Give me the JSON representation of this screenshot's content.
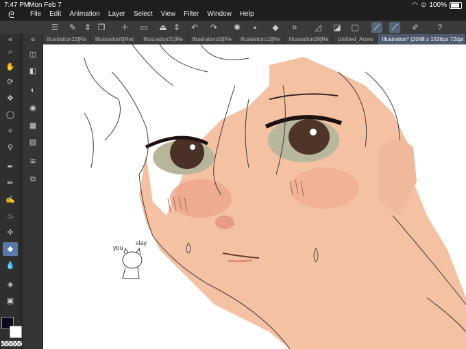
{
  "status": {
    "time": "7:47 PM",
    "date": "Mon Feb 7",
    "battery": "100%"
  },
  "menu": [
    "File",
    "Edit",
    "Animation",
    "Layer",
    "Select",
    "View",
    "Filter",
    "Window",
    "Help"
  ],
  "tabs": [
    {
      "label": "Illustration22[Re",
      "active": false
    },
    {
      "label": "Illustration5[Rec",
      "active": false
    },
    {
      "label": "Illustration31[Re",
      "active": false
    },
    {
      "label": "Illustration33[Re",
      "active": false
    },
    {
      "label": "Illustration12[Re",
      "active": false
    },
    {
      "label": "Illustration29[Re",
      "active": false
    },
    {
      "label": "Untitled_Artwo",
      "active": false
    },
    {
      "label": "Illustration* (2048 x 1536px 72dpi 231.0%)",
      "active": true
    }
  ],
  "canvas_text": {
    "note1": "you",
    "note2": "slay"
  },
  "colors": {
    "foreground": "#0a0a1a",
    "background": "#ffffff",
    "skin": "#f4c1a3",
    "accent": "#5b79a8"
  },
  "icons": {
    "toolbar": [
      "hamburger-icon",
      "new-canvas-icon",
      "chevron-updown-icon",
      "copy-icon",
      "new-file-icon",
      "open-folder-icon",
      "save-icon",
      "chevron-updown-icon",
      "undo-icon",
      "redo-icon",
      "spinner-icon",
      "clear-icon",
      "fill-icon",
      "crop-icon",
      "ruler-icon",
      "snap-icon",
      "snap-line-icon",
      "snap-curve-icon",
      "pen-pressure-icon",
      "help-icon"
    ],
    "tools": [
      "zoom-icon",
      "hand-icon",
      "rotate-icon",
      "move-icon",
      "lasso-icon",
      "magic-wand-icon",
      "eyedropper-icon",
      "pen-icon",
      "pencil-icon",
      "brush-icon",
      "airbrush-icon",
      "decoration-icon",
      "eraser-icon",
      "blend-icon",
      "fill-icon",
      "gradient-icon",
      "figure-icon"
    ]
  }
}
